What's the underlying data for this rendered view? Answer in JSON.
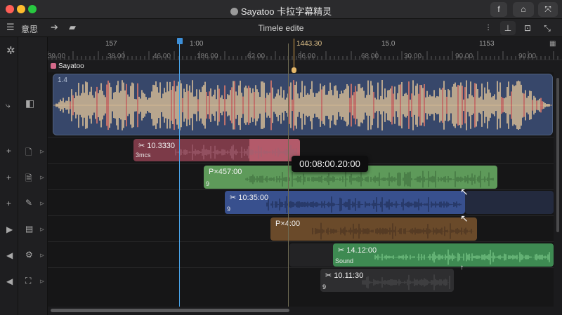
{
  "window": {
    "title": "Sayatoo 卡拉字幕精灵",
    "buttons": {
      "left": "f",
      "middle": "⌂",
      "right": "⤧"
    }
  },
  "toolbar": {
    "menu_label": "意思",
    "center_title": "Timele edite",
    "right_icons": [
      "mixer-icon",
      "align-icon",
      "export-icon"
    ]
  },
  "ruler": {
    "top_labels": [
      "157",
      "1:00",
      "1443.30",
      "15.0",
      "1153"
    ],
    "bottom_labels": [
      "39.00",
      "38.00",
      "46.00",
      "186.00",
      "62.00",
      "86.00",
      "68.00",
      "30.00",
      "90.00",
      "90.00"
    ],
    "track_name": "Sayatoo"
  },
  "master": {
    "tag": "1.4"
  },
  "clips": [
    {
      "name": "10.3330",
      "sub": "3mcs",
      "color": "#8a4150"
    },
    {
      "name": "P×457:00",
      "sub": "9",
      "color": "#5e9a5a"
    },
    {
      "name": "10:35:00",
      "sub": "9",
      "color": "#38508e"
    },
    {
      "name": "P×4:00",
      "sub": "",
      "color": "#6a4a2a"
    },
    {
      "name": "14.12:00",
      "sub": "Sound",
      "color": "#3e8a52"
    },
    {
      "name": "10.11:30",
      "sub": "9",
      "color": "#2e2e30"
    }
  ],
  "tooltip": "00:08:00.20:00",
  "colors": {
    "playhead": "#4aa3e8",
    "marker": "#d9a24a",
    "waveform_master": "#d9bf98"
  }
}
